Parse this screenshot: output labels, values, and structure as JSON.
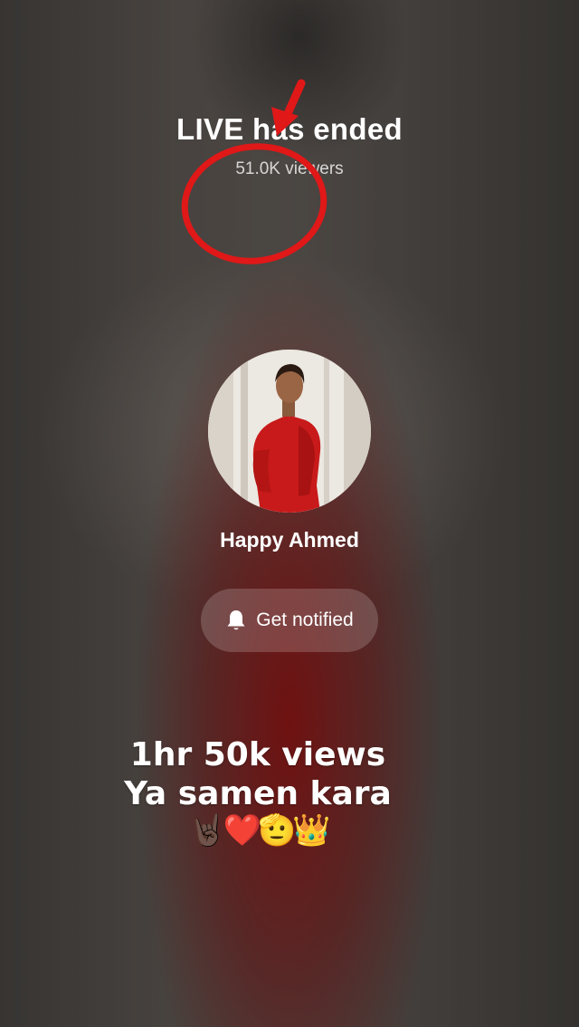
{
  "live": {
    "title": "LIVE has ended",
    "viewers": "51.0K viewers"
  },
  "host": {
    "name": "Happy Ahmed",
    "avatar": "host-photo-red-dress"
  },
  "notify": {
    "label": "Get notified",
    "icon": "bell-icon"
  },
  "caption": {
    "line1": "1hr 50k views",
    "line2": "Ya samen kara",
    "emojis": "🤘🏿❤️🫡👑"
  },
  "annotation": {
    "color": "#e01818",
    "shapes": [
      "arrow",
      "circle"
    ]
  }
}
